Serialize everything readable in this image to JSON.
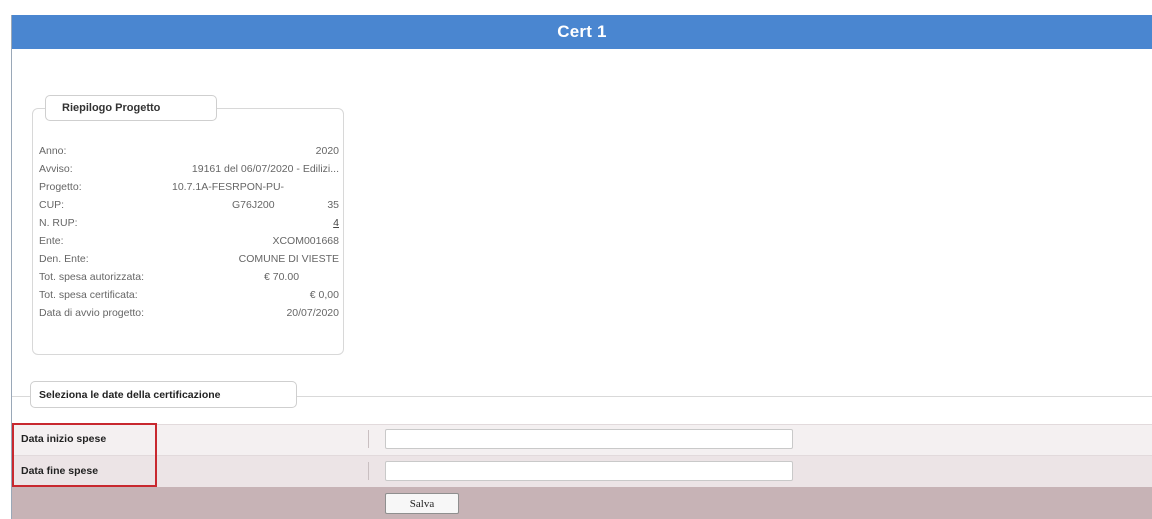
{
  "header": {
    "title": "Cert 1"
  },
  "summary": {
    "title": "Riepilogo Progetto",
    "rows": [
      {
        "label": "Anno:",
        "value": "2020"
      },
      {
        "label": "Avviso:",
        "value": "19161 del 06/07/2020 - Edilizi..."
      },
      {
        "label": "Progetto:",
        "value": "10.7.1A-FESRPON-PU-"
      },
      {
        "label": "CUP:",
        "value": "G76J200",
        "extra": "35"
      },
      {
        "label": "N. RUP:",
        "value": "4"
      },
      {
        "label": "Ente:",
        "value": "XCOM001668"
      },
      {
        "label": "Den. Ente:",
        "value": "COMUNE DI VIESTE"
      },
      {
        "label": "Tot. spesa autorizzata:",
        "value": "€ 70.00"
      },
      {
        "label": "Tot. spesa certificata:",
        "value": "€ 0,00"
      },
      {
        "label": "Data di avvio progetto:",
        "value": "20/07/2020"
      }
    ]
  },
  "dates": {
    "title": "Seleziona le date della certificazione",
    "start_label": "Data inizio spese",
    "start_value": "",
    "end_label": "Data fine spese",
    "end_value": "",
    "save_label": "Salva"
  },
  "colors": {
    "header": "#4a86d0",
    "highlight": "#c8282f",
    "button_bar": "#c7b3b6"
  }
}
